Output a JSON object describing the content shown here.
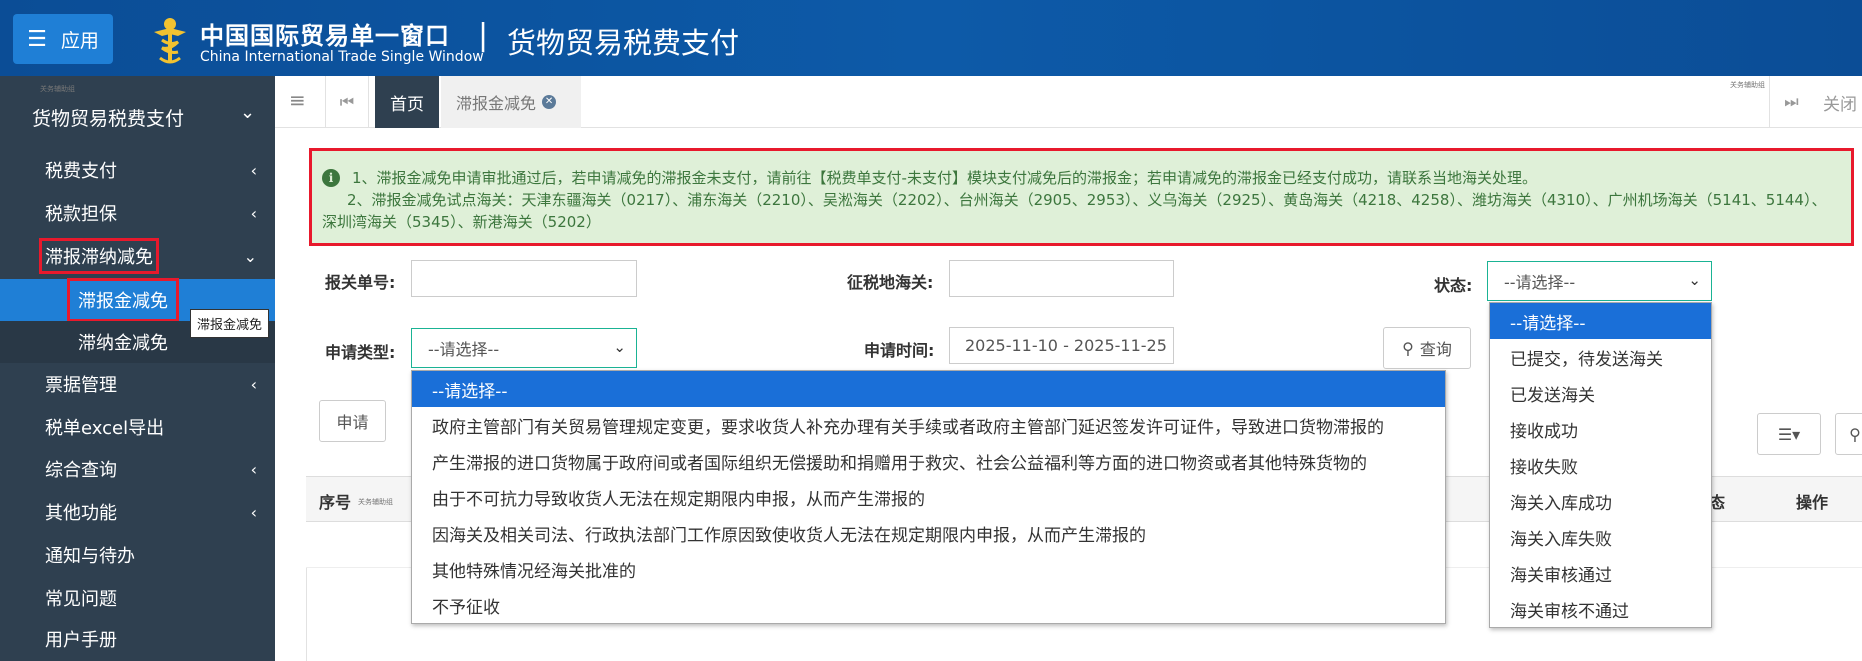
{
  "header": {
    "app_label": "应用",
    "brand_cn": "中国国际贸易单一窗口",
    "brand_en": "China International Trade Single Window",
    "separator": "|",
    "module_title": "货物贸易税费支付"
  },
  "sidebar": {
    "title": "货物贸易税费支付",
    "watermark": "关务辅助组",
    "items": [
      {
        "label": "税费支付",
        "expanded": false
      },
      {
        "label": "税款担保",
        "expanded": false
      },
      {
        "label": "滞报滞纳减免",
        "expanded": true,
        "highlighted": true
      },
      {
        "label": "票据管理",
        "expanded": false
      },
      {
        "label": "税单excel导出",
        "expanded": null
      },
      {
        "label": "综合查询",
        "expanded": false
      },
      {
        "label": "其他功能",
        "expanded": false
      },
      {
        "label": "通知与待办",
        "expanded": null
      },
      {
        "label": "常见问题",
        "expanded": null
      },
      {
        "label": "用户手册",
        "expanded": null
      }
    ],
    "sub_items": [
      {
        "label": "滞报金减免",
        "active": true
      },
      {
        "label": "滞纳金减免",
        "active": false
      }
    ],
    "tooltip": "滞报金减免"
  },
  "tabs": {
    "home": "首页",
    "current": "滞报金减免",
    "close_label": "关闭",
    "watermark": "关务辅助组"
  },
  "notice": {
    "line1": "1、滞报金减免申请审批通过后，若申请减免的滞报金未支付，请前往【税费单支付-未支付】模块支付减免后的滞报金；若申请减免的滞报金已经支付成功，请联系当地海关处理。",
    "line2": "2、滞报金减免试点海关：天津东疆海关（0217）、浦东海关（2210）、吴淞海关（2202）、台州海关（2905、2953）、义乌海关（2925）、黄岛海关（4218、4258）、潍坊海关（4310）、广州机场海关（5141、5144）、深圳湾海关（5345）、新港海关（5202）"
  },
  "form": {
    "declaration_no_label": "报关单号:",
    "declaration_no_value": "",
    "customs_label": "征税地海关:",
    "customs_value": "",
    "status_label": "状态:",
    "status_value": "--请选择--",
    "apply_type_label": "申请类型:",
    "apply_type_value": "--请选择--",
    "apply_time_label": "申请时间:",
    "apply_time_value": "2025-11-10 - 2025-11-25",
    "query_button": "查询",
    "apply_button": "申请"
  },
  "table": {
    "columns": [
      "序号",
      "态",
      "操作"
    ],
    "watermark": "关务辅助组"
  },
  "apply_type_options": [
    "--请选择--",
    "政府主管部门有关贸易管理规定变更，要求收货人补充办理有关手续或者政府主管部门延迟签发许可证件，导致进口货物滞报的",
    "产生滞报的进口货物属于政府间或者国际组织无偿援助和捐赠用于救灾、社会公益福利等方面的进口物资或者其他特殊货物的",
    "由于不可抗力导致收货人无法在规定期限内申报，从而产生滞报的",
    "因海关及相关司法、行政执法部门工作原因致使收货人无法在规定期限内申报，从而产生滞报的",
    "其他特殊情况经海关批准的",
    "不予征收"
  ],
  "status_options": [
    "--请选择--",
    "已提交，待发送海关",
    "已发送海关",
    "接收成功",
    "接收失败",
    "海关入库成功",
    "海关入库失败",
    "海关审核通过",
    "海关审核不通过"
  ],
  "colors": {
    "header_bg": "#0d5aa8",
    "sidebar_bg": "#2f4050",
    "active_blue": "#1f7fd6",
    "highlight_red": "#e8192c",
    "notice_bg": "#dff0d8",
    "notice_text": "#3c763d",
    "select_border": "#1ab394"
  }
}
